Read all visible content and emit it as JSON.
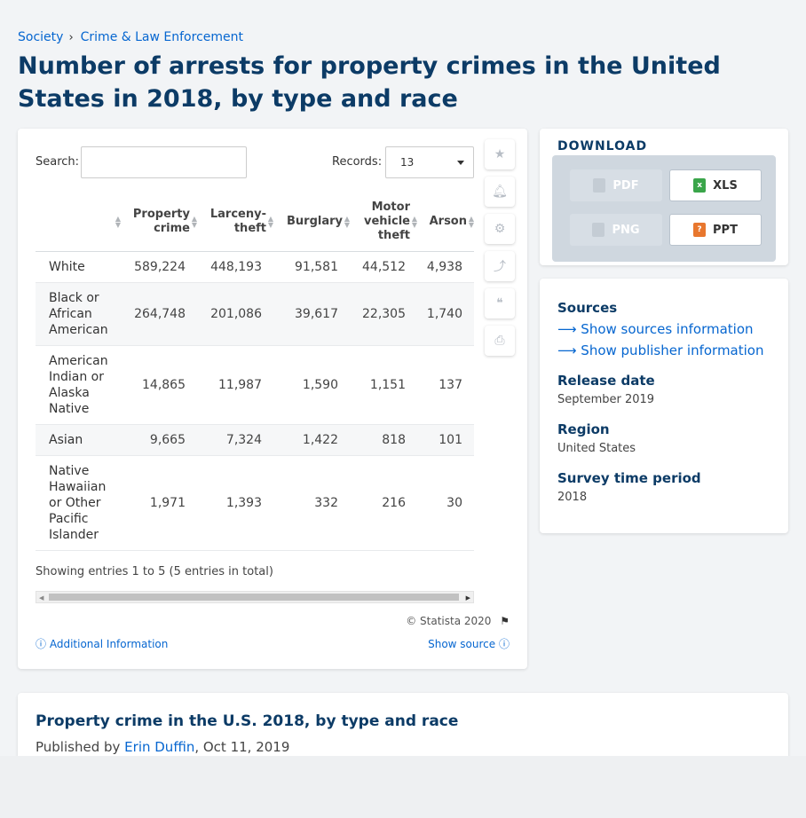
{
  "breadcrumb": {
    "items": [
      "Society",
      "Crime & Law Enforcement"
    ],
    "separator": "›"
  },
  "page": {
    "title": "Number of arrests for property crimes in the United States in 2018, by type and race"
  },
  "controls": {
    "search_label": "Search:",
    "search_value": "",
    "records_label": "Records:",
    "records_value": "13"
  },
  "table": {
    "headers": [
      "",
      "Property crime",
      "Larceny-theft",
      "Burglary",
      "Motor vehicle theft",
      "Arson"
    ],
    "rows": [
      {
        "label": "White",
        "values": [
          "589,224",
          "448,193",
          "91,581",
          "44,512",
          "4,938"
        ]
      },
      {
        "label": "Black or African American",
        "values": [
          "264,748",
          "201,086",
          "39,617",
          "22,305",
          "1,740"
        ]
      },
      {
        "label": "American Indian or Alaska Native",
        "values": [
          "14,865",
          "11,987",
          "1,590",
          "1,151",
          "137"
        ]
      },
      {
        "label": "Asian",
        "values": [
          "9,665",
          "7,324",
          "1,422",
          "818",
          "101"
        ]
      },
      {
        "label": "Native Hawaiian or Other Pacific Islander",
        "values": [
          "1,971",
          "1,393",
          "332",
          "216",
          "30"
        ]
      }
    ]
  },
  "footer": {
    "entries": "Showing entries 1 to 5 (5 entries in total)",
    "copyright": "© Statista 2020",
    "additional_info": "Additional Information",
    "show_source": "Show source"
  },
  "download": {
    "title": "DOWNLOAD",
    "buttons": [
      {
        "label": "PDF",
        "enabled": false
      },
      {
        "label": "XLS",
        "enabled": true
      },
      {
        "label": "PNG",
        "enabled": false
      },
      {
        "label": "PPT",
        "enabled": true
      }
    ]
  },
  "sources": {
    "heading": "Sources",
    "show_sources": "Show sources information",
    "show_publisher": "Show publisher information",
    "release_date_label": "Release date",
    "release_date": "September 2019",
    "region_label": "Region",
    "region": "United States",
    "survey_label": "Survey time period",
    "survey": "2018"
  },
  "publication": {
    "title": "Property crime in the U.S. 2018, by type and race",
    "published_by_label": "Published by",
    "author": "Erin Duffin",
    "date": ", Oct 11, 2019"
  },
  "colors": {
    "accent": "#0666d0",
    "heading": "#0c3b66",
    "xls": "#3aa54a",
    "ppt": "#e8772e"
  }
}
